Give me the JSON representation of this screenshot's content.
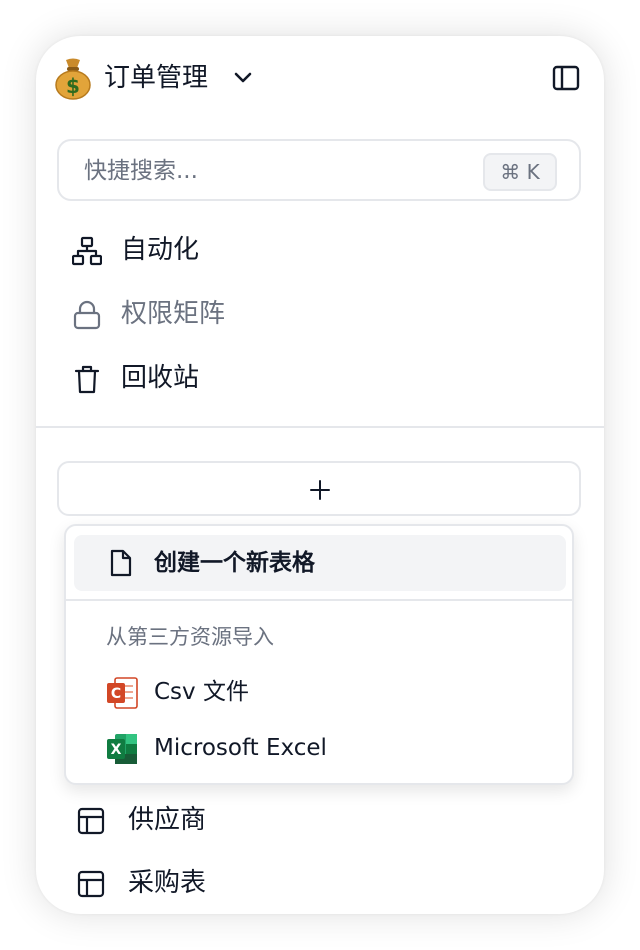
{
  "workspace": {
    "emoji": "money-bag-icon",
    "name": "订单管理"
  },
  "search": {
    "placeholder": "快捷搜索...",
    "shortcut": "⌘ K"
  },
  "nav": [
    {
      "label": "自动化",
      "icon": "sitemap-icon"
    },
    {
      "label": "权限矩阵",
      "icon": "lock-icon"
    },
    {
      "label": "回收站",
      "icon": "trash-icon"
    }
  ],
  "add_button": {
    "icon": "plus-icon"
  },
  "create_menu": {
    "create_label": "创建一个新表格",
    "import_section": "从第三方资源导入",
    "import_items": [
      {
        "label": "Csv 文件",
        "icon": "csv-file-icon"
      },
      {
        "label": "Microsoft Excel",
        "icon": "excel-icon"
      }
    ]
  },
  "tables": [
    {
      "label": "供应商",
      "icon": "table-icon"
    },
    {
      "label": "采购表",
      "icon": "table-icon"
    }
  ],
  "colors": {
    "border": "#e5e7eb",
    "muted_text": "#6b7280",
    "hover_bg": "#f3f4f6",
    "csv_red": "#d24726",
    "excel_green": "#107c41"
  }
}
